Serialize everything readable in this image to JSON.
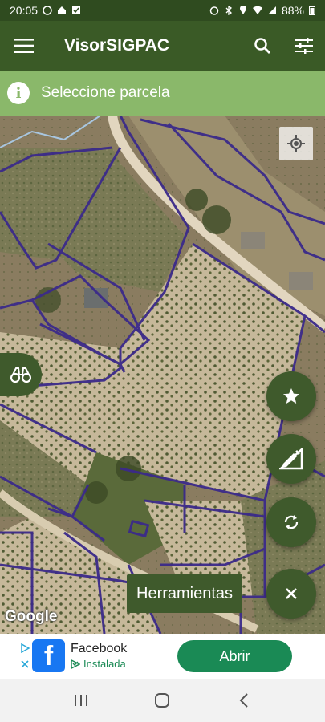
{
  "status": {
    "time": "20:05",
    "battery": "88%"
  },
  "app": {
    "title": "VisorSIGPAC"
  },
  "info": {
    "message": "Seleccione parcela"
  },
  "map": {
    "attribution": "Google"
  },
  "tools": {
    "label": "Herramientas"
  },
  "ad": {
    "title": "Facebook",
    "subtitle": "Instalada",
    "button": "Abrir"
  },
  "colors": {
    "primary": "#3a5a26",
    "info": "#8ab86a",
    "parcel_border": "#3b2a8a",
    "ad_button": "#1a8a55"
  },
  "icons": [
    "menu-icon",
    "search-icon",
    "tune-icon",
    "info-icon",
    "gps-icon",
    "binoculars-icon",
    "star-icon",
    "edit-ruler-icon",
    "sync-icon",
    "close-icon"
  ]
}
